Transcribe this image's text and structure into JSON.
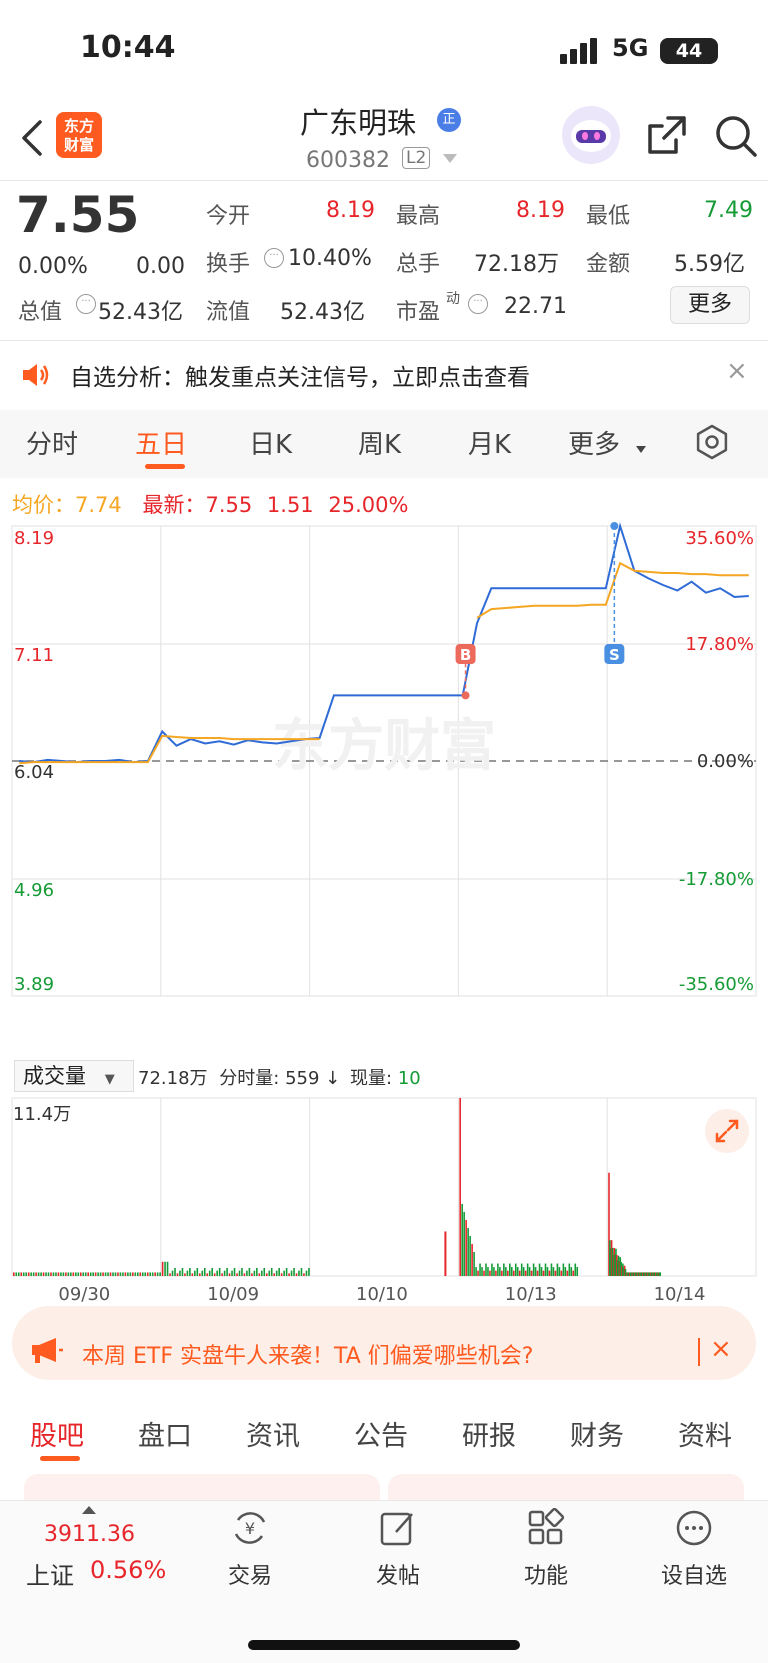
{
  "status": {
    "time": "10:44",
    "network": "5G",
    "battery": "44"
  },
  "header": {
    "logo_line1": "东方",
    "logo_line2": "财富",
    "stock_name": "广东明珠",
    "badge": "正",
    "code": "600382",
    "level": "L2"
  },
  "quote": {
    "price": "7.55",
    "change_pct": "0.00%",
    "change": "0.00",
    "open_label": "今开",
    "open": "8.19",
    "high_label": "最高",
    "high": "8.19",
    "low_label": "最低",
    "low": "7.49",
    "turnover_label": "换手",
    "turnover": "10.40%",
    "volume_label": "总手",
    "volume": "72.18万",
    "amount_label": "金额",
    "amount": "5.59亿",
    "mktcap_label": "总值",
    "mktcap": "52.43亿",
    "float_label": "流值",
    "float": "52.43亿",
    "pe_label": "市盈",
    "pe_sup": "动",
    "pe": "22.71",
    "more": "更多"
  },
  "notice": {
    "text": "自选分析：触发重点关注信号，立即点击查看",
    "close": "×"
  },
  "chart_tabs": [
    "分时",
    "五日",
    "日K",
    "周K",
    "月K",
    "更多"
  ],
  "info_line": {
    "avg_label": "均价：",
    "avg": "7.74",
    "latest_label": "最新：",
    "latest": "7.55",
    "change": "1.51",
    "pct": "25.00%"
  },
  "chart_data": {
    "type": "line",
    "title": "",
    "x_days": [
      "09/30",
      "10/09",
      "10/10",
      "10/13",
      "10/14"
    ],
    "y_left_ticks": [
      "8.19",
      "7.11",
      "6.04",
      "4.96",
      "3.89"
    ],
    "y_right_ticks": [
      "35.60%",
      "17.80%",
      "0.00%",
      "-17.80%",
      "-35.60%"
    ],
    "ylim": [
      3.89,
      8.19
    ],
    "baseline": 6.04,
    "series": [
      {
        "color": "#2f6bd6",
        "values": [
          6.04,
          6.03,
          6.05,
          6.04,
          6.03,
          6.04,
          6.04,
          6.05,
          6.03,
          6.04,
          6.31,
          6.18,
          6.24,
          6.2,
          6.22,
          6.19,
          6.23,
          6.21,
          6.2,
          6.22,
          6.24,
          6.25,
          6.64,
          6.64,
          6.64,
          6.64,
          6.64,
          6.64,
          6.64,
          6.64,
          6.64,
          6.64,
          7.3,
          7.62,
          7.62,
          7.62,
          7.62,
          7.62,
          7.62,
          7.62,
          7.62,
          7.62,
          8.19,
          7.78,
          7.71,
          7.65,
          7.6,
          7.68,
          7.58,
          7.62,
          7.54,
          7.55
        ]
      },
      {
        "color": "#f5a623",
        "values": [
          6.02,
          6.03,
          6.03,
          6.03,
          6.03,
          6.03,
          6.03,
          6.03,
          6.03,
          6.03,
          6.27,
          6.26,
          6.25,
          6.25,
          6.25,
          6.24,
          6.24,
          6.24,
          6.24,
          6.24,
          6.24,
          6.24,
          null,
          null,
          null,
          null,
          null,
          null,
          null,
          null,
          null,
          null,
          7.35,
          7.43,
          7.44,
          7.45,
          7.46,
          7.46,
          7.46,
          7.46,
          7.47,
          7.47,
          7.85,
          7.78,
          7.77,
          7.76,
          7.76,
          7.75,
          7.75,
          7.74,
          7.74,
          7.74
        ]
      }
    ],
    "markers": [
      {
        "label": "B",
        "day": "10/13"
      },
      {
        "label": "S",
        "day": "10/14"
      }
    ],
    "watermark": "东方财富"
  },
  "volume": {
    "selector": "成交量",
    "total": "72.18万",
    "min_label": "分时量:",
    "min_value": "559",
    "arrow": "↓",
    "now_label": "现量:",
    "now_value": "10",
    "max_tick": "11.4万"
  },
  "banner": {
    "text": "本周 ETF 实盘牛人来袭！TA 们偏爱哪些机会?",
    "close": "×"
  },
  "bottom_tabs": [
    "股吧",
    "盘口",
    "资讯",
    "公告",
    "研报",
    "财务",
    "资料"
  ],
  "index": {
    "value": "3911.36",
    "name": "上证",
    "pct": "0.56%"
  },
  "nav": [
    "交易",
    "发帖",
    "功能",
    "设自选"
  ]
}
